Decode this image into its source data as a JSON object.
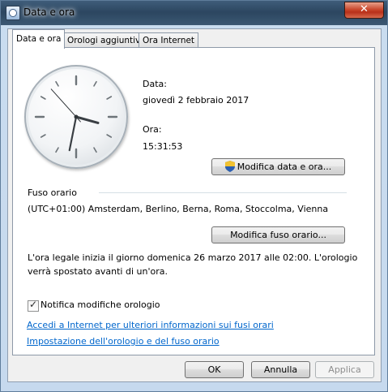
{
  "window": {
    "title": "Data e ora",
    "close_label": "✕"
  },
  "tabs": [
    {
      "label": "Data e ora"
    },
    {
      "label": "Orologi aggiuntivi"
    },
    {
      "label": "Ora Internet"
    }
  ],
  "clock": {
    "hour": 15,
    "minute": 31,
    "second": 53
  },
  "date_section": {
    "date_label": "Data:",
    "date_value": "giovedì 2 febbraio 2017",
    "time_label": "Ora:",
    "time_value": "15:31:53",
    "change_datetime_button": "Modifica data e ora..."
  },
  "timezone": {
    "heading": "Fuso orario",
    "value": "(UTC+01:00) Amsterdam, Berlino, Berna, Roma, Stoccolma, Vienna",
    "change_button": "Modifica fuso orario..."
  },
  "dst_notice": {
    "line1": "L'ora legale inizia il giorno domenica 26 marzo 2017 alle 02:00. L'orologio",
    "line2": "verrà spostato avanti di un'ora."
  },
  "notify_checkbox": {
    "label": "Notifica modifiche orologio",
    "checked": true
  },
  "links": {
    "internet_info": "Accedi a Internet per ulteriori informazioni sui fusi orari",
    "clock_settings": "Impostazione dell'orologio e del fuso orario"
  },
  "footer_buttons": {
    "ok": "OK",
    "cancel": "Annulla",
    "apply": "Applica"
  }
}
